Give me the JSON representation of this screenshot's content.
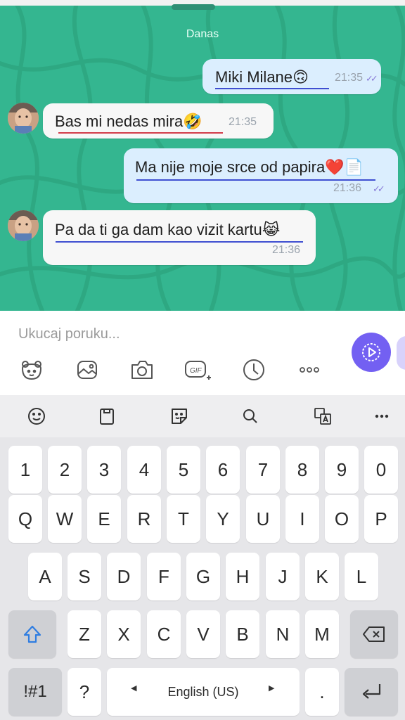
{
  "chat": {
    "date_separator": "Danas",
    "messages": [
      {
        "direction": "outgoing",
        "text": "Miki Milane🙃",
        "time": "21:35",
        "status": "read"
      },
      {
        "direction": "incoming",
        "text": "Bas mi nedas mira🤣",
        "time": "21:35"
      },
      {
        "direction": "outgoing",
        "text": "Ma nije moje srce od papira❤️📄",
        "time": "21:36",
        "status": "read"
      },
      {
        "direction": "incoming",
        "text": "Pa da ti ga dam kao vizit kartu😹",
        "time": "21:36"
      }
    ],
    "colors": {
      "background": "#34b690",
      "outgoing_bubble": "#dbeefe",
      "incoming_bubble": "#f7f7f7",
      "read_ticks": "#8a7cd8"
    }
  },
  "composer": {
    "placeholder": "Ukucaj poruku...",
    "tools": [
      "sticker-icon",
      "gallery-icon",
      "camera-icon",
      "gif-icon",
      "timer-icon",
      "more-icon"
    ],
    "send_color": "#7360f2"
  },
  "keyboard": {
    "toolbar": [
      "emoji-icon",
      "clipboard-icon",
      "sticker-icon",
      "search-icon",
      "translate-icon",
      "more-icon"
    ],
    "row_numbers": [
      "1",
      "2",
      "3",
      "4",
      "5",
      "6",
      "7",
      "8",
      "9",
      "0"
    ],
    "row_1": [
      "Q",
      "W",
      "E",
      "R",
      "T",
      "Y",
      "U",
      "I",
      "O",
      "P"
    ],
    "row_2": [
      "A",
      "S",
      "D",
      "F",
      "G",
      "H",
      "J",
      "K",
      "L"
    ],
    "row_3": [
      "Z",
      "X",
      "C",
      "V",
      "B",
      "N",
      "M"
    ],
    "symbols_key": "!#1",
    "question_key": "?",
    "space_label": "English (US)",
    "period_key": "."
  }
}
